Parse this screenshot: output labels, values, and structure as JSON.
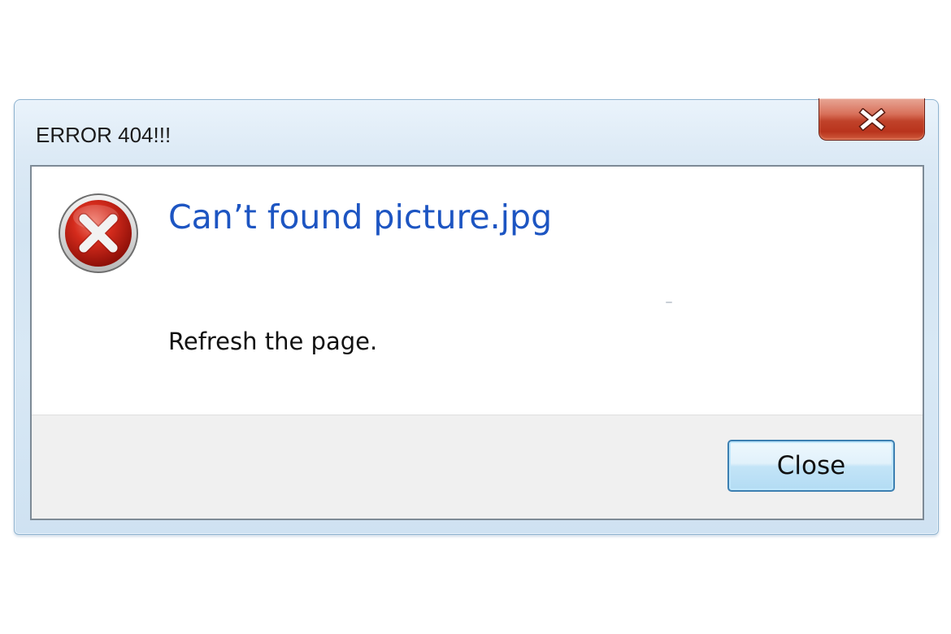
{
  "window": {
    "title": "ERROR 404!!!",
    "close_icon": "close-x-icon"
  },
  "dialog": {
    "icon": "error-icon",
    "main_instruction": "Can’t found picture.jpg",
    "content": "Refresh the page."
  },
  "footer": {
    "close_label": "Close"
  },
  "colors": {
    "instruction": "#1d55c2",
    "close_x": "#c0422a",
    "button_border": "#3c7fb1"
  }
}
